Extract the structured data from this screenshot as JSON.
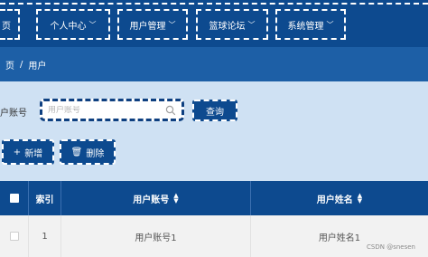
{
  "nav": {
    "items": [
      {
        "label": "页",
        "chevron": false
      },
      {
        "label": "个人中心",
        "chevron": true
      },
      {
        "label": "用户管理",
        "chevron": true
      },
      {
        "label": "篮球论坛",
        "chevron": true
      },
      {
        "label": "系统管理",
        "chevron": true
      }
    ],
    "chevron_glyph": "﹀"
  },
  "breadcrumb": {
    "parent": "页",
    "separator": "/",
    "current": "用户"
  },
  "search": {
    "label": "户账号",
    "placeholder": "用户账号",
    "button": "查询"
  },
  "actions": {
    "add_icon": "+",
    "add_label": "新增",
    "delete_icon": "🗑",
    "delete_label": "删除"
  },
  "table": {
    "headers": {
      "index": "索引",
      "account": "用户账号",
      "name": "用户姓名"
    },
    "rows": [
      {
        "index": "1",
        "account": "用户账号1",
        "name": "用户姓名1"
      }
    ]
  },
  "watermark": "CSDN @snesen",
  "colors": {
    "primary": "#0d4a8f",
    "breadcrumb": "#1d5fa6",
    "content_bg": "#cfe1f3"
  }
}
